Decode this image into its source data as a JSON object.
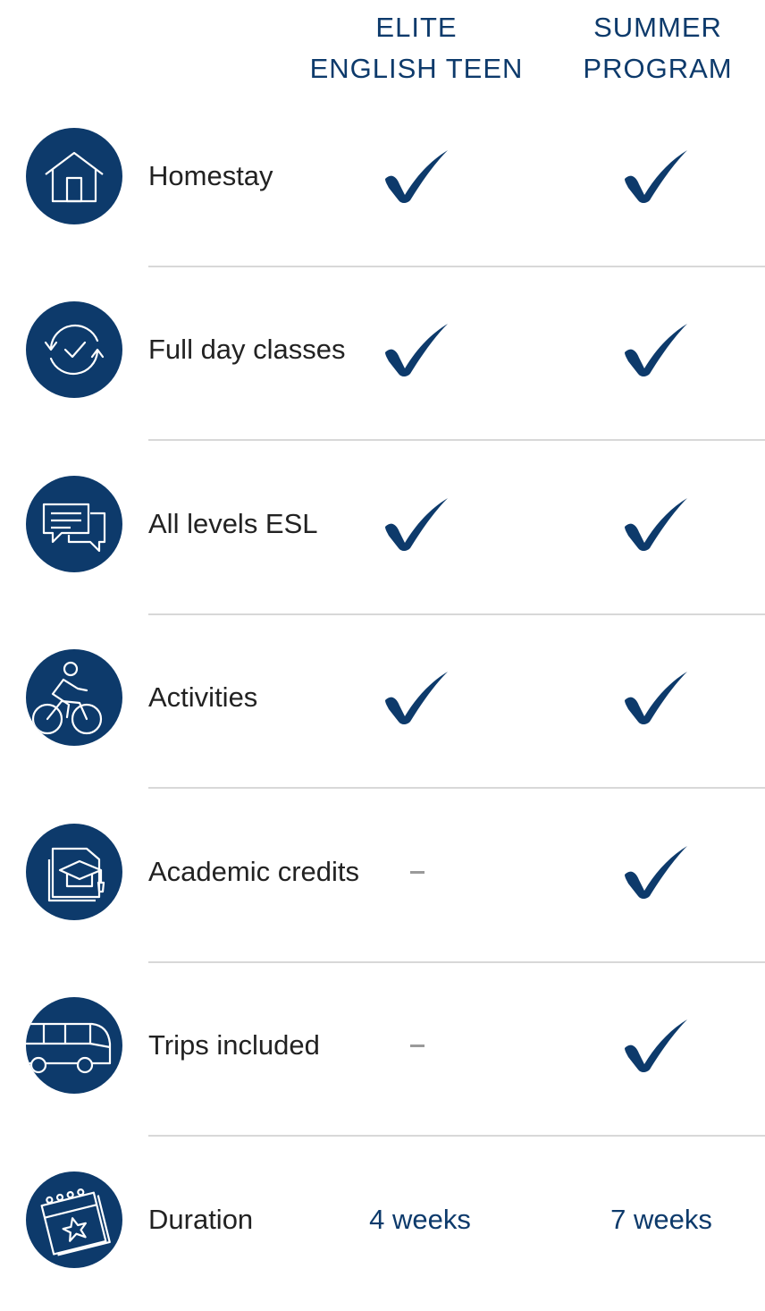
{
  "columns": {
    "col1": {
      "line1": "ELITE",
      "line2": "ENGLISH TEEN"
    },
    "col2": {
      "line1": "SUMMER",
      "line2": "PROGRAM"
    }
  },
  "rows": [
    {
      "label": "Homestay",
      "icon": "house-icon",
      "col1": "check",
      "col2": "check"
    },
    {
      "label": "Full day classes",
      "icon": "clock-check-icon",
      "col1": "check",
      "col2": "check"
    },
    {
      "label": "All levels ESL",
      "icon": "chat-bubbles-icon",
      "col1": "check",
      "col2": "check"
    },
    {
      "label": "Activities",
      "icon": "cyclist-icon",
      "col1": "check",
      "col2": "check"
    },
    {
      "label": "Academic credits",
      "icon": "graduation-cap-icon",
      "col1": "dash",
      "col2": "check"
    },
    {
      "label": "Trips included",
      "icon": "bus-icon",
      "col1": "dash",
      "col2": "check"
    },
    {
      "label": "Duration",
      "icon": "calendar-star-icon",
      "col1": "4 weeks",
      "col2": "7 weeks"
    }
  ],
  "colors": {
    "brand": "#0d3a6b",
    "text": "#222222",
    "divider": "#d8d8d8",
    "dash": "#9a9a9a"
  }
}
